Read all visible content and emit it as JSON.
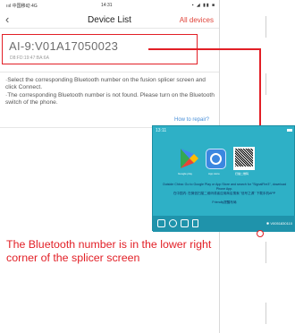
{
  "status_bar": {
    "left": "ıııl 中国移动 4G",
    "time": "14:31",
    "right": "▪ ◢ ▮▮ ■"
  },
  "nav": {
    "back_icon": "chevron-left-icon",
    "back_glyph": "‹",
    "title": "Device List",
    "action": "All devices"
  },
  "device": {
    "id": "AI-9:V01A17050023",
    "sub": "D8:FD:19:47:BA:6A"
  },
  "hint": {
    "line1": "·Select the corresponding Bluetooth number on the fusion splicer screen and click Connect.",
    "line2": "·The corresponding Bluetooth number is not found. Please turn on the Bluetooth switch of the phone."
  },
  "how_to": "How to repair?",
  "splicer": {
    "time": "13:11",
    "google_play": "Google play",
    "app_store": "App store",
    "wechat": "扫描二维码",
    "text_line1": "Outside China: Go to Google Play or App Store and search for \"SignalFire3\", download Phone App.",
    "text_line2": "在中国内: 在微信扫描二维码或者应用商店搜索 \"信号之源\" 下载手机APP",
    "text_line3": "Friendly提醒布局",
    "bluetooth": "✱ V0051830110"
  },
  "caption": "The Bluetooth number is in the lower right corner of the splicer screen",
  "colors": {
    "accent_red": "#e21f26",
    "splicer_teal": "#2eb0c6",
    "link_blue": "#4a90d9"
  }
}
